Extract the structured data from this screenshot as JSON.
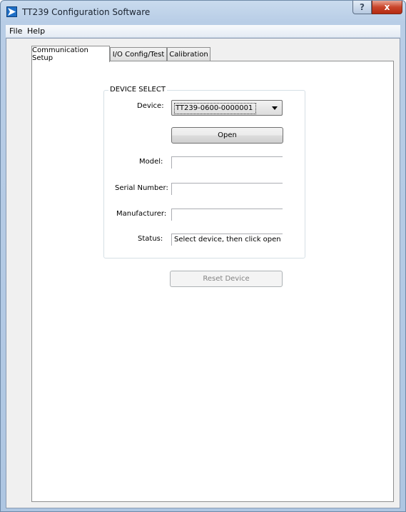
{
  "window": {
    "title": "TT239 Configuration Software",
    "help_button": "?",
    "close_button": "x"
  },
  "menu": {
    "file": "File",
    "help": "Help"
  },
  "tabs": [
    {
      "label": "Communication Setup",
      "active": true
    },
    {
      "label": "I/O Config/Test",
      "active": false
    },
    {
      "label": "Calibration",
      "active": false
    }
  ],
  "device_select": {
    "group_title": "DEVICE SELECT",
    "device_label": "Device:",
    "device_value": "TT239-0600-0000001",
    "open_button": "Open",
    "model_label": "Model:",
    "model_value": "",
    "serial_label": "Serial Number:",
    "serial_value": "",
    "manufacturer_label": "Manufacturer:",
    "manufacturer_value": "",
    "status_label": "Status:",
    "status_value": "Select device, then click open"
  },
  "reset_button": "Reset Device"
}
